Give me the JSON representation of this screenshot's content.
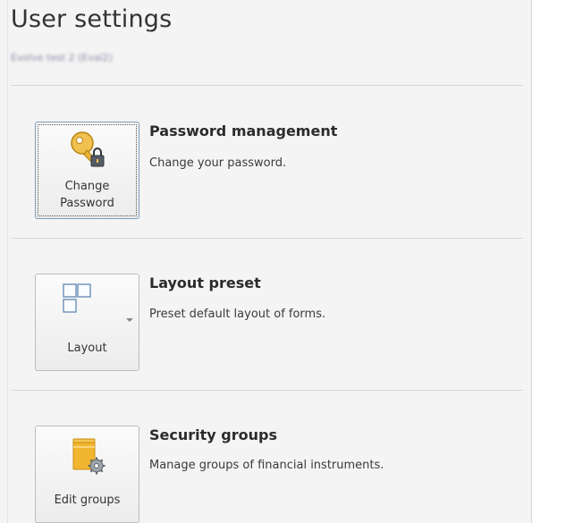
{
  "header": {
    "title": "User settings",
    "subtitle": "Evolve test 2 (Eval2)"
  },
  "sections": [
    {
      "button_label_line1": "Change",
      "button_label_line2": "Password",
      "title": "Password management",
      "description": "Change your password.",
      "icon": "key-lock-icon"
    },
    {
      "button_label": "Layout",
      "title": "Layout preset",
      "description": "Preset default layout of forms.",
      "icon": "layout-grid-icon"
    },
    {
      "button_label": "Edit groups",
      "title": "Security groups",
      "description": "Manage groups of financial instruments.",
      "icon": "folder-gear-icon"
    }
  ],
  "colors": {
    "panel_background": "#f4f4f4",
    "key_gold": "#e8b33a",
    "folder_orange": "#f1b52f"
  }
}
